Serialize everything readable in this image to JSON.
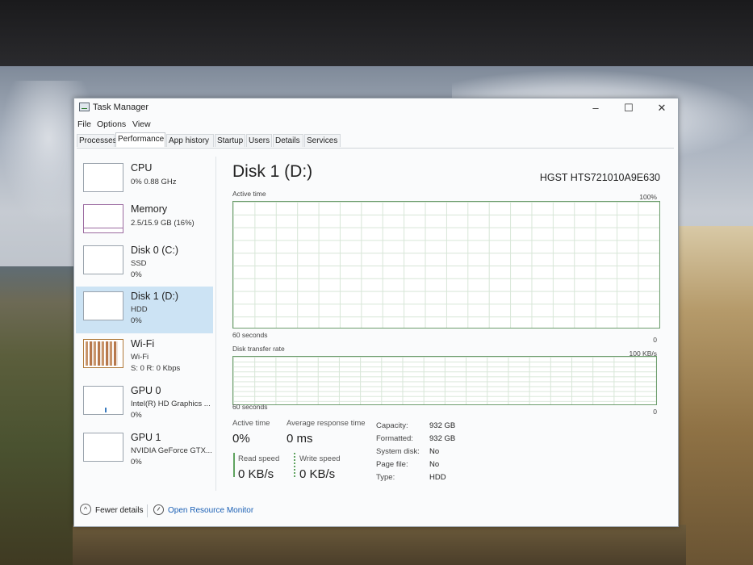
{
  "window": {
    "title": "Task Manager",
    "minimize": "–",
    "maximize": "☐",
    "close": "✕"
  },
  "menu": [
    "File",
    "Options",
    "View"
  ],
  "tabs": [
    "Processes",
    "Performance",
    "App history",
    "Startup",
    "Users",
    "Details",
    "Services"
  ],
  "active_tab": "Performance",
  "sidebar": {
    "items": [
      {
        "name": "CPU",
        "line1": "0% 0.88 GHz",
        "line2": ""
      },
      {
        "name": "Memory",
        "line1": "2.5/15.9 GB (16%)",
        "line2": ""
      },
      {
        "name": "Disk 0 (C:)",
        "line1": "SSD",
        "line2": "0%"
      },
      {
        "name": "Disk 1 (D:)",
        "line1": "HDD",
        "line2": "0%",
        "selected": true
      },
      {
        "name": "Wi-Fi",
        "line1": "Wi-Fi",
        "line2": "S: 0 R: 0 Kbps"
      },
      {
        "name": "GPU 0",
        "line1": "Intel(R) HD Graphics ...",
        "line2": "0%"
      },
      {
        "name": "GPU 1",
        "line1": "NVIDIA GeForce GTX...",
        "line2": "0%"
      }
    ]
  },
  "detail": {
    "title": "Disk 1 (D:)",
    "model": "HGST HTS721010A9E630",
    "graph1": {
      "label": "Active time",
      "max": "100%",
      "time": "60 seconds",
      "min": "0"
    },
    "graph2": {
      "label": "Disk transfer rate",
      "max": "100 KB/s",
      "time": "60 seconds",
      "min": "0"
    },
    "active_time": {
      "label": "Active time",
      "value": "0%"
    },
    "avg_response": {
      "label": "Average response time",
      "value": "0 ms"
    },
    "read_speed": {
      "label": "Read speed",
      "value": "0 KB/s"
    },
    "write_speed": {
      "label": "Write speed",
      "value": "0 KB/s"
    },
    "info": [
      {
        "label": "Capacity:",
        "value": "932 GB"
      },
      {
        "label": "Formatted:",
        "value": "932 GB"
      },
      {
        "label": "System disk:",
        "value": "No"
      },
      {
        "label": "Page file:",
        "value": "No"
      },
      {
        "label": "Type:",
        "value": "HDD"
      }
    ]
  },
  "footer": {
    "fewer_details": "Fewer details",
    "open_resmon": "Open Resource Monitor"
  },
  "colors": {
    "selected": "#cce3f4",
    "graph_border": "#6d9d6d",
    "link": "#1a5fb4"
  }
}
